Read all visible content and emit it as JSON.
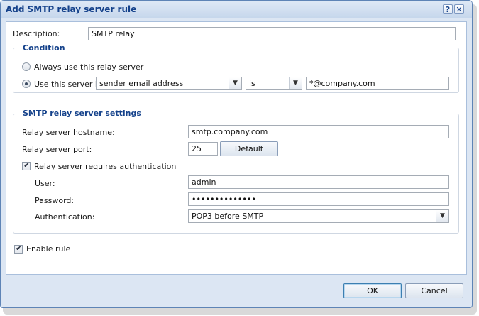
{
  "window": {
    "title": "Add SMTP relay server rule",
    "help_label": "?",
    "close_label": "✕"
  },
  "description": {
    "label": "Description:",
    "value": "SMTP relay"
  },
  "condition": {
    "legend": "Condition",
    "always_label": "Always use this relay server",
    "use_if_label": "Use this server if",
    "field_select": "sender email address",
    "operator_select": "is",
    "value": "*@company.com",
    "selected": "use_if"
  },
  "settings": {
    "legend": "SMTP relay server settings",
    "hostname_label": "Relay server hostname:",
    "hostname_value": "smtp.company.com",
    "port_label": "Relay server port:",
    "port_value": "25",
    "default_button": "Default",
    "auth_required_label": "Relay server requires authentication",
    "auth_required": true,
    "user_label": "User:",
    "user_value": "admin",
    "password_label": "Password:",
    "password_value": "••••••••••••••",
    "auth_label": "Authentication:",
    "auth_select": "POP3 before SMTP"
  },
  "enable_rule": {
    "label": "Enable rule",
    "checked": true
  },
  "buttons": {
    "ok": "OK",
    "cancel": "Cancel"
  },
  "icons": {
    "dropdown": "chevron-down-icon",
    "check": "checkmark-icon"
  },
  "colors": {
    "title": "#15428b",
    "frame": "#dce6f3",
    "border": "#5e84b6"
  }
}
